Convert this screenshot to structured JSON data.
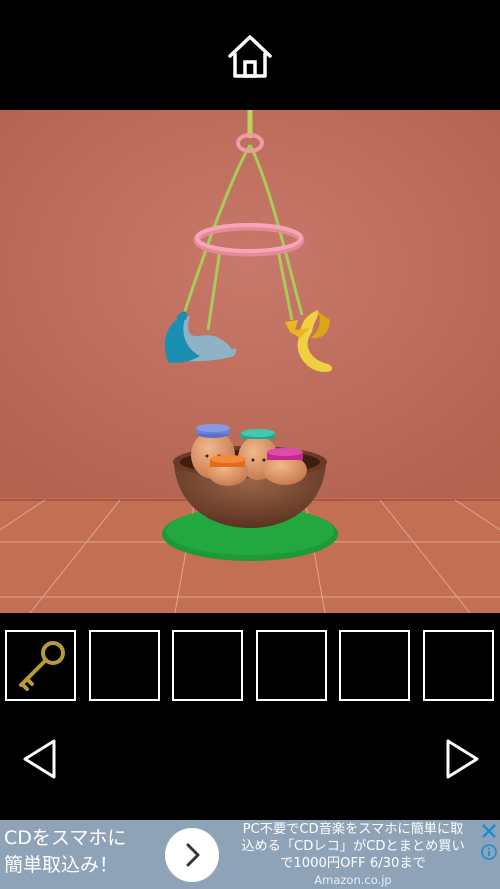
{
  "header": {
    "home_icon": "home-icon"
  },
  "scene": {
    "description_items": [
      "baby-mobile",
      "pink-ring",
      "blue-whale-ornament",
      "yellow-moon-ornament",
      "wooden-bowl",
      "capped-figures",
      "green-mat"
    ],
    "colors": {
      "wall": "#c0705f",
      "floor": "#c06f55",
      "ring": "#f09aa8",
      "mat": "#1fa03a",
      "bowl": "#7a4a32"
    }
  },
  "inventory": {
    "slots": [
      {
        "item": "gold-key",
        "icon": "key-icon"
      },
      {
        "item": ""
      },
      {
        "item": ""
      },
      {
        "item": ""
      },
      {
        "item": ""
      },
      {
        "item": ""
      }
    ]
  },
  "navigation": {
    "left_icon": "left-arrow-icon",
    "right_icon": "right-arrow-icon"
  },
  "ad": {
    "left_line1": "CDをスマホに",
    "left_line2": "簡単取込み！",
    "right_line1": "PC不要でCD音楽をスマホに簡単に取",
    "right_line2": "込める「CDレコ」がCDとまとめ買い",
    "right_line3": "で1000円OFF 6/30まで",
    "source": "Amazon.co.jp"
  }
}
